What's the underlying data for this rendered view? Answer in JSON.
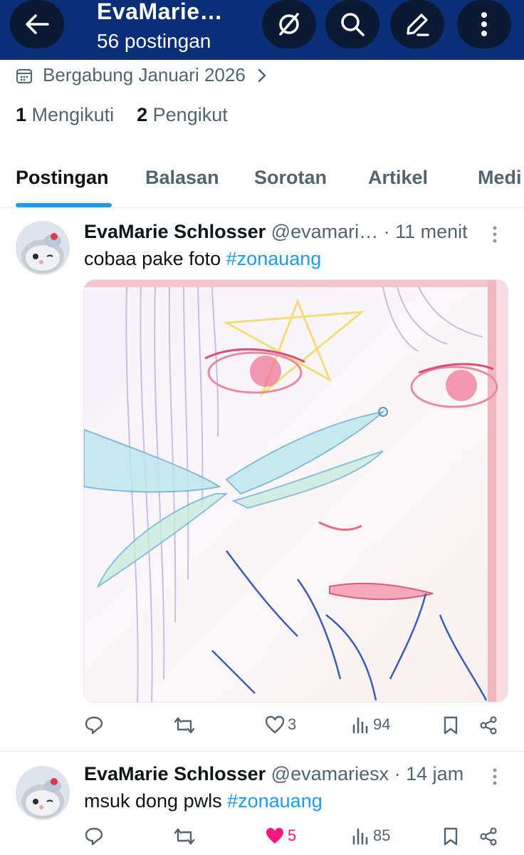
{
  "header": {
    "title": "EvaMarie…",
    "subtitle": "56 postingan",
    "icons": [
      "back-arrow-icon",
      "grok-icon",
      "search-icon",
      "edit-icon",
      "more-vertical-icon"
    ]
  },
  "profile": {
    "joined": "Bergabung Januari 2026",
    "following_count": "1",
    "following_label": "Mengikuti",
    "followers_count": "2",
    "followers_label": "Pengikut"
  },
  "tabs": [
    {
      "label": "Postingan",
      "active": true
    },
    {
      "label": "Balasan",
      "active": false
    },
    {
      "label": "Sorotan",
      "active": false
    },
    {
      "label": "Artikel",
      "active": false
    },
    {
      "label": "Medi",
      "active": false
    }
  ],
  "posts": [
    {
      "name": "EvaMarie Schlosser",
      "handle": "@evamari…",
      "time": "· 11 menit",
      "text": "cobaa pake foto ",
      "hashtag": "#zonauang",
      "has_media": true,
      "actions": {
        "replies": "",
        "reposts": "",
        "likes": "3",
        "views": "94",
        "liked": false
      }
    },
    {
      "name": "EvaMarie Schlosser",
      "handle": "@evamariesx",
      "time": "· 14 jam",
      "text": "msuk dong pwls ",
      "hashtag": "#zonauang",
      "has_media": false,
      "actions": {
        "replies": "",
        "reposts": "",
        "likes": "5",
        "views": "85",
        "liked": true
      }
    }
  ],
  "colors": {
    "header_bg": "#0a2f78",
    "accent": "#1d9bf0",
    "like": "#f91880",
    "secondary_text": "#536471"
  }
}
